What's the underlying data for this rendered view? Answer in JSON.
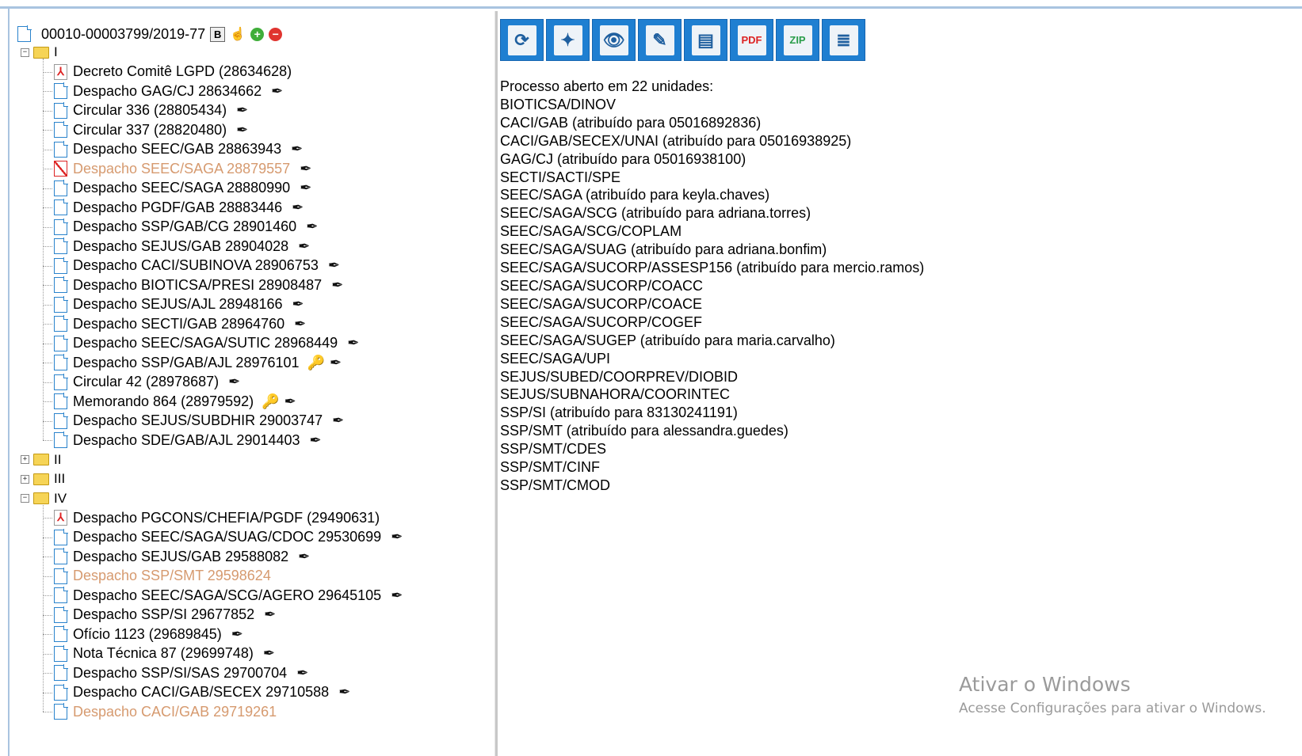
{
  "process": {
    "number": "00010-00003799/2019-77",
    "b_label": "B"
  },
  "volumes": [
    {
      "label": "I",
      "expanded": true,
      "docs": [
        {
          "name": "Decreto Comitê LGPD (28634628)",
          "icon": "pdf-icon",
          "pen": false,
          "key": false,
          "style": "normal"
        },
        {
          "name": "Despacho GAG/CJ 28634662",
          "icon": "document-icon",
          "pen": true,
          "key": false,
          "style": "normal"
        },
        {
          "name": "Circular 336 (28805434)",
          "icon": "document-icon",
          "pen": true,
          "key": false,
          "style": "normal"
        },
        {
          "name": "Circular 337 (28820480)",
          "icon": "document-icon",
          "pen": true,
          "key": false,
          "style": "normal"
        },
        {
          "name": "Despacho SEEC/GAB 28863943",
          "icon": "document-icon",
          "pen": true,
          "key": false,
          "style": "normal"
        },
        {
          "name": "Despacho SEEC/SAGA 28879557",
          "icon": "cancelled-document-icon",
          "pen": true,
          "key": false,
          "style": "orange"
        },
        {
          "name": "Despacho SEEC/SAGA 28880990",
          "icon": "document-icon",
          "pen": true,
          "key": false,
          "style": "normal"
        },
        {
          "name": "Despacho PGDF/GAB 28883446",
          "icon": "document-icon",
          "pen": true,
          "key": false,
          "style": "normal"
        },
        {
          "name": "Despacho SSP/GAB/CG 28901460",
          "icon": "document-icon",
          "pen": true,
          "key": false,
          "style": "normal"
        },
        {
          "name": "Despacho SEJUS/GAB 28904028",
          "icon": "document-icon",
          "pen": true,
          "key": false,
          "style": "normal"
        },
        {
          "name": "Despacho CACI/SUBINOVA 28906753",
          "icon": "document-icon",
          "pen": true,
          "key": false,
          "style": "normal"
        },
        {
          "name": "Despacho BIOTICSA/PRESI 28908487",
          "icon": "document-icon",
          "pen": true,
          "key": false,
          "style": "normal"
        },
        {
          "name": "Despacho SEJUS/AJL 28948166",
          "icon": "document-icon",
          "pen": true,
          "key": false,
          "style": "normal"
        },
        {
          "name": "Despacho SECTI/GAB 28964760",
          "icon": "document-icon",
          "pen": true,
          "key": false,
          "style": "normal"
        },
        {
          "name": "Despacho SEEC/SAGA/SUTIC 28968449",
          "icon": "document-icon",
          "pen": true,
          "key": false,
          "style": "normal"
        },
        {
          "name": "Despacho SSP/GAB/AJL 28976101",
          "icon": "document-icon",
          "pen": true,
          "key": true,
          "style": "normal"
        },
        {
          "name": "Circular 42 (28978687)",
          "icon": "document-icon",
          "pen": true,
          "key": false,
          "style": "normal"
        },
        {
          "name": "Memorando 864 (28979592)",
          "icon": "document-icon",
          "pen": true,
          "key": true,
          "style": "normal"
        },
        {
          "name": "Despacho SEJUS/SUBDHIR 29003747",
          "icon": "document-icon",
          "pen": true,
          "key": false,
          "style": "normal"
        },
        {
          "name": "Despacho SDE/GAB/AJL 29014403",
          "icon": "document-icon",
          "pen": true,
          "key": false,
          "style": "normal"
        }
      ]
    },
    {
      "label": "II",
      "expanded": false,
      "docs": []
    },
    {
      "label": "III",
      "expanded": false,
      "docs": []
    },
    {
      "label": "IV",
      "expanded": true,
      "docs": [
        {
          "name": "Despacho PGCONS/CHEFIA/PGDF (29490631)",
          "icon": "pdf-icon",
          "pen": false,
          "key": false,
          "style": "normal"
        },
        {
          "name": "Despacho SEEC/SAGA/SUAG/CDOC 29530699",
          "icon": "document-icon",
          "pen": true,
          "key": false,
          "style": "normal"
        },
        {
          "name": "Despacho SEJUS/GAB 29588082",
          "icon": "document-icon",
          "pen": true,
          "key": false,
          "style": "normal"
        },
        {
          "name": "Despacho SSP/SMT 29598624",
          "icon": "document-icon",
          "pen": false,
          "key": false,
          "style": "orange"
        },
        {
          "name": "Despacho SEEC/SAGA/SCG/AGERO 29645105",
          "icon": "document-icon",
          "pen": true,
          "key": false,
          "style": "normal"
        },
        {
          "name": "Despacho SSP/SI 29677852",
          "icon": "document-icon",
          "pen": true,
          "key": false,
          "style": "normal"
        },
        {
          "name": "Ofício 1123 (29689845)",
          "icon": "document-icon",
          "pen": true,
          "key": false,
          "style": "normal"
        },
        {
          "name": "Nota Técnica 87 (29699748)",
          "icon": "document-icon",
          "pen": true,
          "key": false,
          "style": "normal"
        },
        {
          "name": "Despacho SSP/SI/SAS 29700704",
          "icon": "document-icon",
          "pen": true,
          "key": false,
          "style": "normal"
        },
        {
          "name": "Despacho CACI/GAB/SECEX 29710588",
          "icon": "document-icon",
          "pen": true,
          "key": false,
          "style": "normal"
        },
        {
          "name": "Despacho CACI/GAB 29719261",
          "icon": "document-icon",
          "pen": false,
          "key": false,
          "style": "orange"
        }
      ]
    }
  ],
  "toolbar": [
    {
      "name": "refresh-button",
      "glyph": "⟳",
      "label": ""
    },
    {
      "name": "interested-parties-button",
      "glyph": "✦",
      "label": ""
    },
    {
      "name": "view-access-button",
      "glyph": "👁",
      "label": ""
    },
    {
      "name": "notes-button",
      "glyph": "✎",
      "label": ""
    },
    {
      "name": "folder-button",
      "glyph": "▤",
      "label": ""
    },
    {
      "name": "generate-pdf-button",
      "glyph": "",
      "label": "PDF"
    },
    {
      "name": "generate-zip-button",
      "glyph": "",
      "label": "ZIP"
    },
    {
      "name": "list-button",
      "glyph": "≣",
      "label": ""
    }
  ],
  "info": {
    "heading": "Processo aberto em 22 unidades:",
    "units": [
      "BIOTICSA/DINOV",
      "CACI/GAB (atribuído para 05016892836)",
      "CACI/GAB/SECEX/UNAI (atribuído para 05016938925)",
      "GAG/CJ (atribuído para 05016938100)",
      "SECTI/SACTI/SPE",
      "SEEC/SAGA (atribuído para keyla.chaves)",
      "SEEC/SAGA/SCG (atribuído para adriana.torres)",
      "SEEC/SAGA/SCG/COPLAM",
      "SEEC/SAGA/SUAG (atribuído para adriana.bonfim)",
      "SEEC/SAGA/SUCORP/ASSESP156 (atribuído para mercio.ramos)",
      "SEEC/SAGA/SUCORP/COACC",
      "SEEC/SAGA/SUCORP/COACE",
      "SEEC/SAGA/SUCORP/COGEF",
      "SEEC/SAGA/SUGEP (atribuído para maria.carvalho)",
      "SEEC/SAGA/UPI",
      "SEJUS/SUBED/COORPREV/DIOBID",
      "SEJUS/SUBNAHORA/COORINTEC",
      "SSP/SI (atribuído para 83130241191)",
      "SSP/SMT (atribuído para alessandra.guedes)",
      "SSP/SMT/CDES",
      "SSP/SMT/CINF",
      "SSP/SMT/CMOD"
    ]
  },
  "watermark": {
    "title": "Ativar o Windows",
    "subtitle": "Acesse Configurações para ativar o Windows."
  },
  "colors": {
    "accent": "#1f7fd1",
    "cancelled_text": "#d69a6f",
    "frame": "#a9c4e0"
  }
}
